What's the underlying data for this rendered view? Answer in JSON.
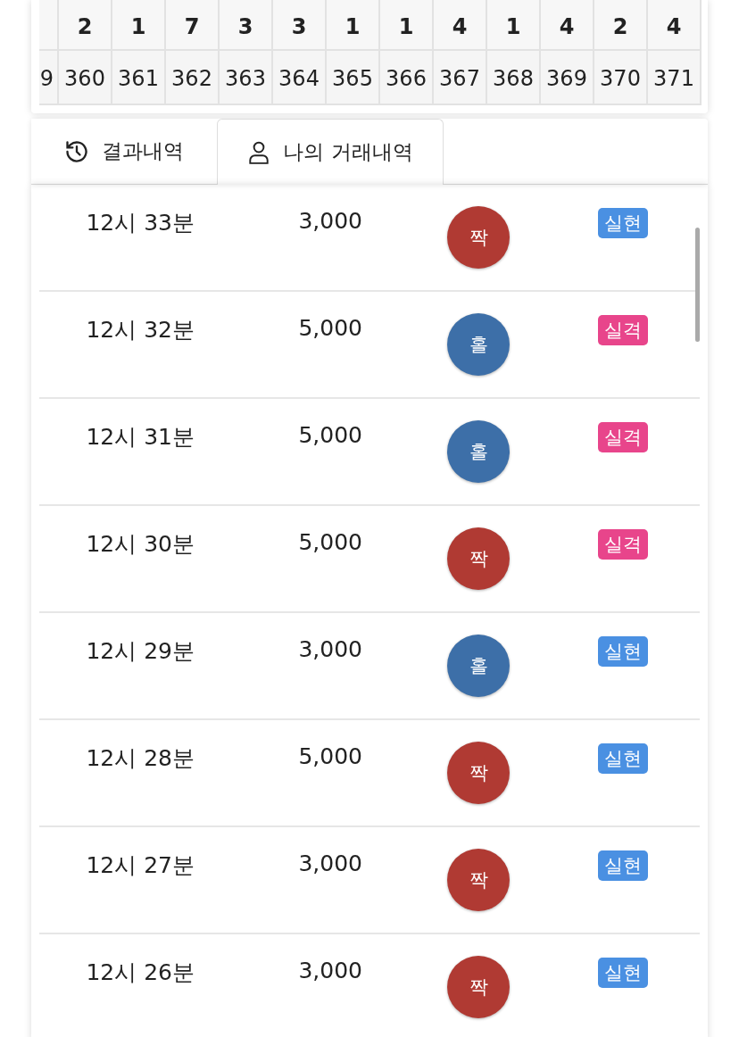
{
  "round_table": {
    "columns": [
      {
        "round": "9"
      },
      {
        "count": "2",
        "round": "360"
      },
      {
        "count": "1",
        "round": "361"
      },
      {
        "count": "7",
        "round": "362"
      },
      {
        "count": "3",
        "round": "363"
      },
      {
        "count": "3",
        "round": "364"
      },
      {
        "count": "1",
        "round": "365"
      },
      {
        "count": "1",
        "round": "366"
      },
      {
        "count": "4",
        "round": "367"
      },
      {
        "count": "1",
        "round": "368"
      },
      {
        "count": "4",
        "round": "369"
      },
      {
        "count": "2",
        "round": "370"
      },
      {
        "count": "4",
        "round": "371"
      }
    ]
  },
  "tabs": [
    {
      "label": "결과내역",
      "kind": "history",
      "selected": false
    },
    {
      "label": "나의 거래내역",
      "kind": "user",
      "selected": true
    }
  ],
  "trades": [
    {
      "time": "12시 33분",
      "amount": "3,000",
      "pick": {
        "label": "짝",
        "kind": "even"
      },
      "result": {
        "label": "실현",
        "kind": "hit"
      }
    },
    {
      "time": "12시 32분",
      "amount": "5,000",
      "pick": {
        "label": "홀",
        "kind": "odd"
      },
      "result": {
        "label": "실격",
        "kind": "miss"
      }
    },
    {
      "time": "12시 31분",
      "amount": "5,000",
      "pick": {
        "label": "홀",
        "kind": "odd"
      },
      "result": {
        "label": "실격",
        "kind": "miss"
      }
    },
    {
      "time": "12시 30분",
      "amount": "5,000",
      "pick": {
        "label": "짝",
        "kind": "even"
      },
      "result": {
        "label": "실격",
        "kind": "miss"
      }
    },
    {
      "time": "12시 29분",
      "amount": "3,000",
      "pick": {
        "label": "홀",
        "kind": "odd"
      },
      "result": {
        "label": "실현",
        "kind": "hit"
      }
    },
    {
      "time": "12시 28분",
      "amount": "5,000",
      "pick": {
        "label": "짝",
        "kind": "even"
      },
      "result": {
        "label": "실현",
        "kind": "hit"
      }
    },
    {
      "time": "12시 27분",
      "amount": "3,000",
      "pick": {
        "label": "짝",
        "kind": "even"
      },
      "result": {
        "label": "실현",
        "kind": "hit"
      }
    },
    {
      "time": "12시 26분",
      "amount": "3,000",
      "pick": {
        "label": "짝",
        "kind": "even"
      },
      "result": {
        "label": "실현",
        "kind": "hit"
      }
    }
  ]
}
